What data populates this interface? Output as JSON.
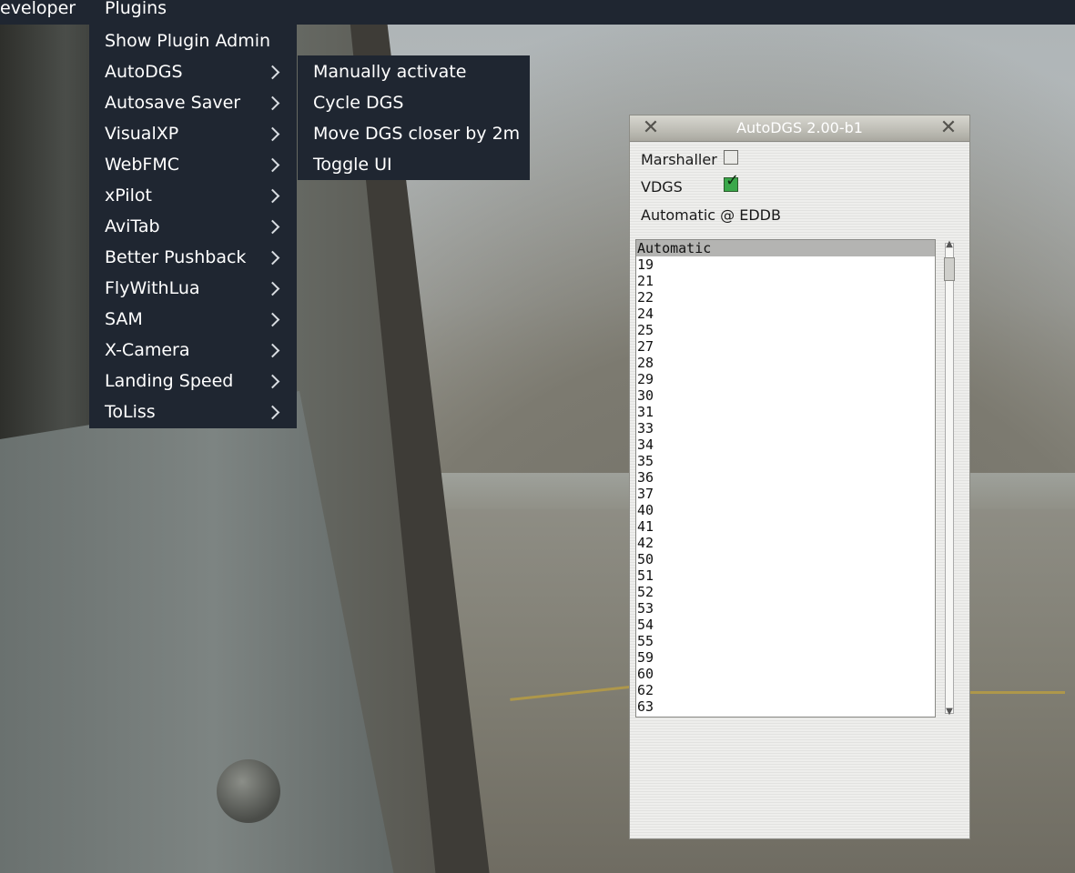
{
  "menubar": {
    "items": [
      "eveloper",
      "Plugins"
    ]
  },
  "plugins_menu": {
    "items": [
      {
        "label": "Show Plugin Admin",
        "submenu": false
      },
      {
        "label": "AutoDGS",
        "submenu": true
      },
      {
        "label": "Autosave Saver",
        "submenu": true
      },
      {
        "label": "VisualXP",
        "submenu": true
      },
      {
        "label": "WebFMC",
        "submenu": true
      },
      {
        "label": "xPilot",
        "submenu": true
      },
      {
        "label": "AviTab",
        "submenu": true
      },
      {
        "label": "Better Pushback",
        "submenu": true
      },
      {
        "label": "FlyWithLua",
        "submenu": true
      },
      {
        "label": "SAM",
        "submenu": true
      },
      {
        "label": "X-Camera",
        "submenu": true
      },
      {
        "label": "Landing Speed",
        "submenu": true
      },
      {
        "label": "ToLiss",
        "submenu": true
      }
    ]
  },
  "autodgs_submenu": {
    "items": [
      "Manually activate",
      "Cycle DGS",
      "Move DGS closer by 2m",
      "Toggle UI"
    ]
  },
  "dialog": {
    "title": "AutoDGS 2.00-b1",
    "close_glyph": "✕",
    "marshaller_label": "Marshaller",
    "marshaller_checked": false,
    "vdgs_label": "VDGS",
    "vdgs_checked": true,
    "status_text": "Automatic @ EDDB",
    "stand_list": [
      "Automatic",
      "19",
      "21",
      "22",
      "24",
      "25",
      "27",
      "28",
      "29",
      "30",
      "31",
      "33",
      "34",
      "35",
      "36",
      "37",
      "40",
      "41",
      "42",
      "50",
      "51",
      "52",
      "53",
      "54",
      "55",
      "59",
      "60",
      "62",
      "63"
    ],
    "selected": "Automatic"
  },
  "colors": {
    "menu_bg": "#1f2631",
    "menu_text": "#ffffff",
    "check_on": "#3aa84a"
  }
}
